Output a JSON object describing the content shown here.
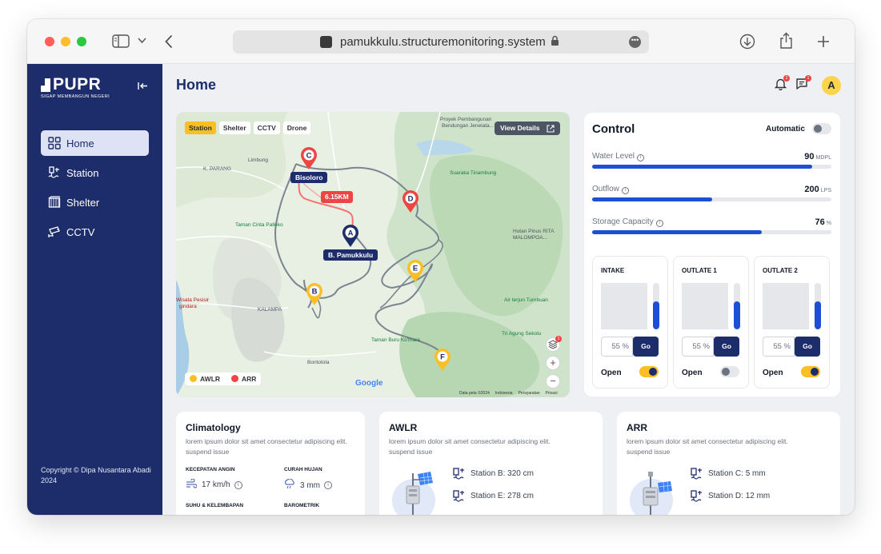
{
  "browser": {
    "url": "pamukkulu.structuremonitoring.system"
  },
  "sidebar": {
    "logo_text": "PUPR",
    "logo_sub": "SIGAP MEMBANGUN NEGERI",
    "items": [
      {
        "label": "Home",
        "icon": "grid-icon",
        "active": true
      },
      {
        "label": "Station",
        "icon": "station-icon",
        "active": false
      },
      {
        "label": "Shelter",
        "icon": "shelter-icon",
        "active": false
      },
      {
        "label": "CCTV",
        "icon": "cctv-icon",
        "active": false
      }
    ],
    "copyright": "Copyright © Dipa Nusantara Abadi 2024"
  },
  "header": {
    "title": "Home",
    "notification_count": "2",
    "message_count": "1",
    "avatar_initial": "A"
  },
  "map": {
    "chips": [
      "Station",
      "Shelter",
      "CCTV",
      "Drone"
    ],
    "active_chip": "Station",
    "view_details": "View Details",
    "distance": "6.15KM",
    "stations": {
      "bisoloro": "Bisoloro",
      "pamukkulu": "B. Pamukkulu"
    },
    "pins": {
      "a": "A",
      "b": "B",
      "c": "C",
      "d": "D",
      "e": "E",
      "f": "F"
    },
    "places": {
      "proyek": "Proyek Pembangunan",
      "bendungan": "Bendungan Jenelata...",
      "limbung": "Limbung",
      "kparang": "K. PARANG",
      "suaraka": "Suaraka Tinambung",
      "taman_cinta": "Taman Cinta Palleko",
      "hutan_pinus": "Hutan Pinus RITA",
      "malompoa": "MALOMPOA...",
      "wisata": "Wisata Pesisir",
      "gindara": "gindara",
      "kalampa": "KALAMPA",
      "air_terjun": "Air terjun Tumbuan",
      "tri_agung": "Tri Agung Sekolu",
      "taman_buru": "Taman Buru Ko'mara",
      "bontotola": "Bontotola"
    },
    "legend": [
      {
        "label": "AWLR",
        "color": "#fbbf24"
      },
      {
        "label": "ARR",
        "color": "#ef4444"
      }
    ],
    "layer_badge": "1",
    "google": "Google",
    "attribution": [
      "Data peta ©2024",
      "Indonesia",
      "Persyaratan",
      "Privasi"
    ]
  },
  "control": {
    "title": "Control",
    "automatic_label": "Automatic",
    "automatic_on": false,
    "meters": [
      {
        "label": "Water Level",
        "value": "90",
        "unit": "MDPL",
        "fill": 0.92
      },
      {
        "label": "Outflow",
        "value": "200",
        "unit": "LPS",
        "fill": 0.5
      },
      {
        "label": "Storage Capacity",
        "value": "76",
        "unit": "%",
        "fill": 0.71
      }
    ],
    "gates": [
      {
        "title": "INTAKE",
        "input": "55 %",
        "go": "Go",
        "open_label": "Open",
        "open_on": true,
        "level": 0.6
      },
      {
        "title": "OUTLATE 1",
        "input": "55 %",
        "go": "Go",
        "open_label": "Open",
        "open_on": false,
        "level": 0.6
      },
      {
        "title": "OUTLATE 2",
        "input": "55 %",
        "go": "Go",
        "open_label": "Open",
        "open_on": true,
        "level": 0.6
      }
    ]
  },
  "climatology": {
    "title": "Climatology",
    "desc": "lorem ipsum dolor sit amet consectetur adipiscing elit. suspend issue",
    "stats": [
      {
        "label": "KECEPATAN ANGIN",
        "value": "17 km/h",
        "icon": "wind-icon"
      },
      {
        "label": "CURAH HUJAN",
        "value": "3 mm",
        "icon": "rain-icon"
      },
      {
        "label": "SUHU & KELEMBAPAN",
        "value": "",
        "icon": "thermometer-icon"
      },
      {
        "label": "BAROMETRIK",
        "value": "",
        "icon": "barometer-icon"
      }
    ]
  },
  "awlr": {
    "title": "AWLR",
    "desc": "lorem ipsum dolor sit amet consectetur adipiscing elit. suspend issue",
    "stations": [
      "Station B: 320 cm",
      "Station E: 278 cm"
    ]
  },
  "arr": {
    "title": "ARR",
    "desc": "lorem ipsum dolor sit amet consectetur adipiscing elit. suspend issue",
    "stations": [
      "Station C: 5 mm",
      "Station D: 12 mm"
    ]
  }
}
